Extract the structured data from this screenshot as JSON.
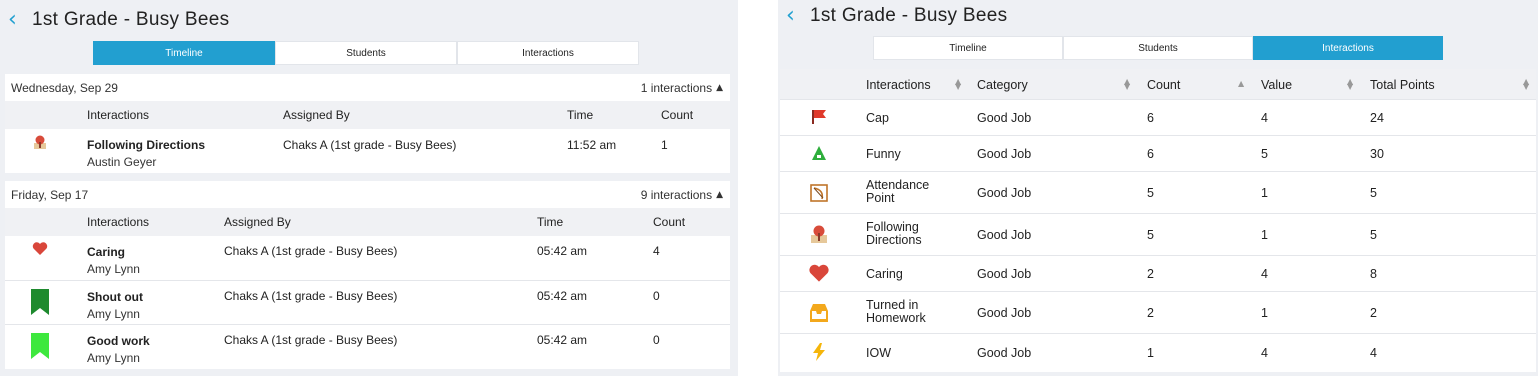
{
  "left": {
    "title": "1st Grade - Busy Bees",
    "tabs": [
      "Timeline",
      "Students",
      "Interactions"
    ],
    "active_tab": "Timeline",
    "days": [
      {
        "date": "Wednesday, Sep 29",
        "count_label": "1 interactions",
        "columns": [
          "Interactions",
          "Assigned By",
          "Time",
          "Count"
        ],
        "rows": [
          {
            "icon": "map-pin-icon",
            "name": "Following Directions",
            "student": "Austin Geyer",
            "assigned_by": "Chaks A (1st grade - Busy Bees)",
            "time": "11:52 am",
            "count": "1"
          }
        ]
      },
      {
        "date": "Friday, Sep 17",
        "count_label": "9 interactions",
        "columns": [
          "Interactions",
          "Assigned By",
          "Time",
          "Count"
        ],
        "rows": [
          {
            "icon": "heart-icon",
            "name": "Caring",
            "student": "Amy Lynn",
            "assigned_by": "Chaks A (1st grade - Busy Bees)",
            "time": "05:42 am",
            "count": "4"
          },
          {
            "icon": "dark-green-ribbon-icon",
            "name": "Shout out",
            "student": "Amy Lynn",
            "assigned_by": "Chaks A (1st grade - Busy Bees)",
            "time": "05:42 am",
            "count": "0"
          },
          {
            "icon": "light-green-ribbon-icon",
            "name": "Good work",
            "student": "Amy Lynn",
            "assigned_by": "Chaks A (1st grade - Busy Bees)",
            "time": "05:42 am",
            "count": "0"
          }
        ]
      }
    ]
  },
  "right": {
    "title": "1st Grade - Busy Bees",
    "tabs": [
      "Timeline",
      "Students",
      "Interactions"
    ],
    "active_tab": "Interactions",
    "columns": [
      "Interactions",
      "Category",
      "Count",
      "Value",
      "Total Points"
    ],
    "rows": [
      {
        "icon": "flag-icon",
        "name_lines": [
          "Cap"
        ],
        "category": "Good Job",
        "count": "6",
        "value": "4",
        "total": "24"
      },
      {
        "icon": "tree-icon",
        "name_lines": [
          "Funny"
        ],
        "category": "Good Job",
        "count": "6",
        "value": "5",
        "total": "30"
      },
      {
        "icon": "bow-icon",
        "name_lines": [
          "Attendance",
          "Point"
        ],
        "category": "Good Job",
        "count": "5",
        "value": "1",
        "total": "5"
      },
      {
        "icon": "map-pin-icon",
        "name_lines": [
          "Following",
          "Directions"
        ],
        "category": "Good Job",
        "count": "5",
        "value": "1",
        "total": "5"
      },
      {
        "icon": "heart-icon",
        "name_lines": [
          "Caring"
        ],
        "category": "Good Job",
        "count": "2",
        "value": "4",
        "total": "8"
      },
      {
        "icon": "inbox-icon",
        "name_lines": [
          "Turned in",
          "Homework"
        ],
        "category": "Good Job",
        "count": "2",
        "value": "1",
        "total": "2"
      },
      {
        "icon": "lightning-icon",
        "name_lines": [
          "IOW"
        ],
        "category": "Good Job",
        "count": "1",
        "value": "4",
        "total": "4"
      }
    ]
  },
  "colors": {
    "accent": "#229fd0",
    "heart": "#d9463a",
    "dark_green": "#1e8a2e",
    "light_green": "#3ee83e",
    "flag": "#e0392b",
    "lightning": "#f5b50a",
    "inbox": "#f3a81c"
  }
}
